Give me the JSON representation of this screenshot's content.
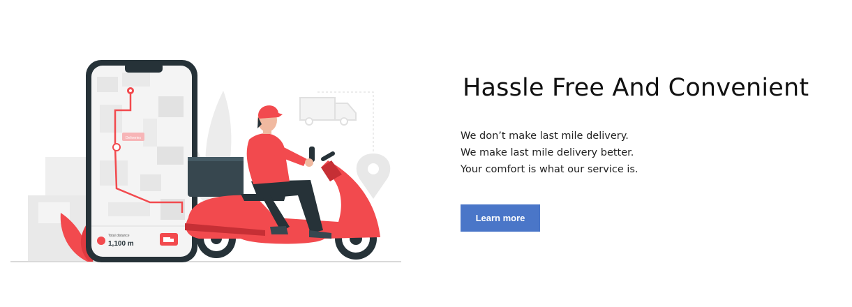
{
  "hero": {
    "headline": "Hassle Free And Convenient",
    "lines": [
      "We don’t make last mile delivery.",
      "We make last mile delivery better.",
      "Your comfort is what our service is."
    ],
    "cta_label": "Learn more"
  },
  "illustration": {
    "map_label": "Deliveries",
    "distance_caption": "Total distance",
    "distance_value": "1,100 m"
  },
  "colors": {
    "accent_button": "#4a76c8",
    "illustration_red": "#f24a4e",
    "illustration_dark": "#263238",
    "illustration_gray": "#e6e6e6"
  },
  "icons": [
    "location-pin-icon",
    "delivery-truck-icon",
    "map-pin-icon"
  ]
}
